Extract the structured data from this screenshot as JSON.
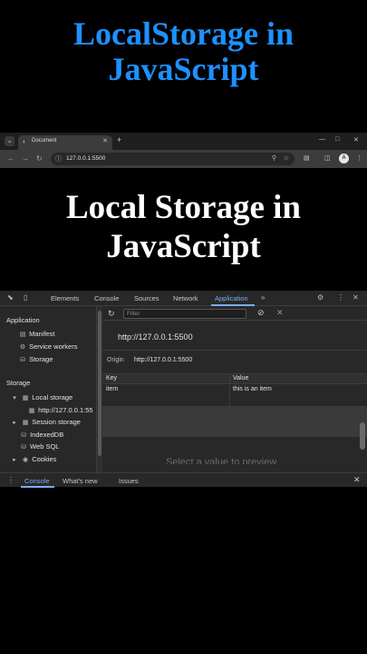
{
  "banner": {
    "line1": "LocalStorage in",
    "line2": "JavaScript"
  },
  "browser": {
    "tab_title": "Document",
    "url": "127.0.0.1:5500",
    "profile_initial": "A"
  },
  "page": {
    "heading_line1": "Local Storage in",
    "heading_line2": "JavaScript"
  },
  "devtools": {
    "tabs": [
      "Elements",
      "Console",
      "Sources",
      "Network",
      "Application"
    ],
    "active_tab": "Application",
    "sidebar": {
      "application_header": "Application",
      "application_items": [
        "Manifest",
        "Service workers",
        "Storage"
      ],
      "storage_header": "Storage",
      "storage_items": {
        "local_storage": "Local storage",
        "local_storage_origin": "http://127.0.0.1:55",
        "session_storage": "Session storage",
        "indexeddb": "IndexedDB",
        "websql": "Web SQL",
        "cookies": "Cookies"
      }
    },
    "main": {
      "filter_placeholder": "Filter",
      "origin_heading": "http://127.0.0.1:5500",
      "origin_label": "Origin",
      "origin_value": "http://127.0.0.1:5500",
      "columns": [
        "Key",
        "Value"
      ],
      "rows": [
        {
          "key": "item",
          "value": "this is an item"
        }
      ],
      "preview_text": "Select a value to preview"
    },
    "drawer": {
      "tabs": [
        "Console",
        "What's new",
        "Issues"
      ],
      "active_tab": "Console"
    }
  },
  "colors": {
    "banner": "#1e90ff",
    "accent": "#7cacf8",
    "panel": "#282828"
  }
}
